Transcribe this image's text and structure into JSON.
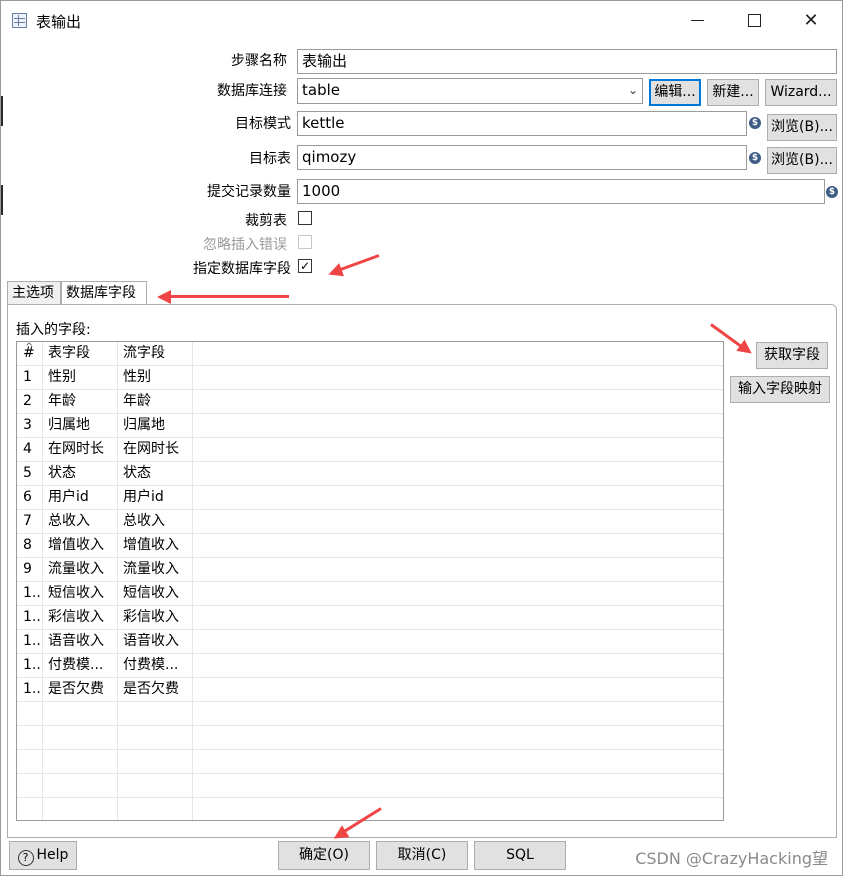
{
  "window": {
    "title": "表输出",
    "controls": {
      "minimize": "",
      "maximize": "",
      "close": "✕"
    }
  },
  "form": {
    "step_name_label": "步骤名称",
    "step_name_value": "表输出",
    "db_connection_label": "数据库连接",
    "db_connection_value": "table",
    "edit_label": "编辑...",
    "new_label": "新建...",
    "wizard_label": "Wizard...",
    "target_schema_label": "目标模式",
    "target_schema_value": "kettle",
    "browse_label": "浏览(B)...",
    "target_table_label": "目标表",
    "target_table_value": "qimozy",
    "commit_size_label": "提交记录数量",
    "commit_size_value": "1000",
    "truncate_label": "裁剪表",
    "truncate_checked": false,
    "ignore_errors_label": "忽略插入错误",
    "ignore_errors_checked": false,
    "specify_fields_label": "指定数据库字段",
    "specify_fields_checked": true,
    "variable_icon": "$"
  },
  "tabs": [
    {
      "label": "主选项",
      "active": false
    },
    {
      "label": "数据库字段",
      "active": true
    }
  ],
  "fields_panel": {
    "label": "插入的字段:",
    "columns": [
      "#",
      "表字段",
      "流字段"
    ],
    "rows": [
      [
        "1",
        "性别",
        "性别"
      ],
      [
        "2",
        "年龄",
        "年龄"
      ],
      [
        "3",
        "归属地",
        "归属地"
      ],
      [
        "4",
        "在网时长",
        "在网时长"
      ],
      [
        "5",
        "状态",
        "状态"
      ],
      [
        "6",
        "用户id",
        "用户id"
      ],
      [
        "7",
        "总收入",
        "总收入"
      ],
      [
        "8",
        "增值收入",
        "增值收入"
      ],
      [
        "9",
        "流量收入",
        "流量收入"
      ],
      [
        "1..",
        "短信收入",
        "短信收入"
      ],
      [
        "1..",
        "彩信收入",
        "彩信收入"
      ],
      [
        "1..",
        "语音收入",
        "语音收入"
      ],
      [
        "1..",
        "付费模...",
        "付费模..."
      ],
      [
        "1..",
        "是否欠费",
        "是否欠费"
      ]
    ],
    "get_fields_label": "获取字段",
    "field_mapping_label": "输入字段映射"
  },
  "footer": {
    "help_label": "Help",
    "help_icon": "?",
    "ok_label": "确定(O)",
    "cancel_label": "取消(C)",
    "sql_label": "SQL"
  },
  "watermark": "CSDN @CrazyHacking望",
  "colors": {
    "annotation_arrow": "#f04545",
    "focus_border": "#0078d7"
  }
}
